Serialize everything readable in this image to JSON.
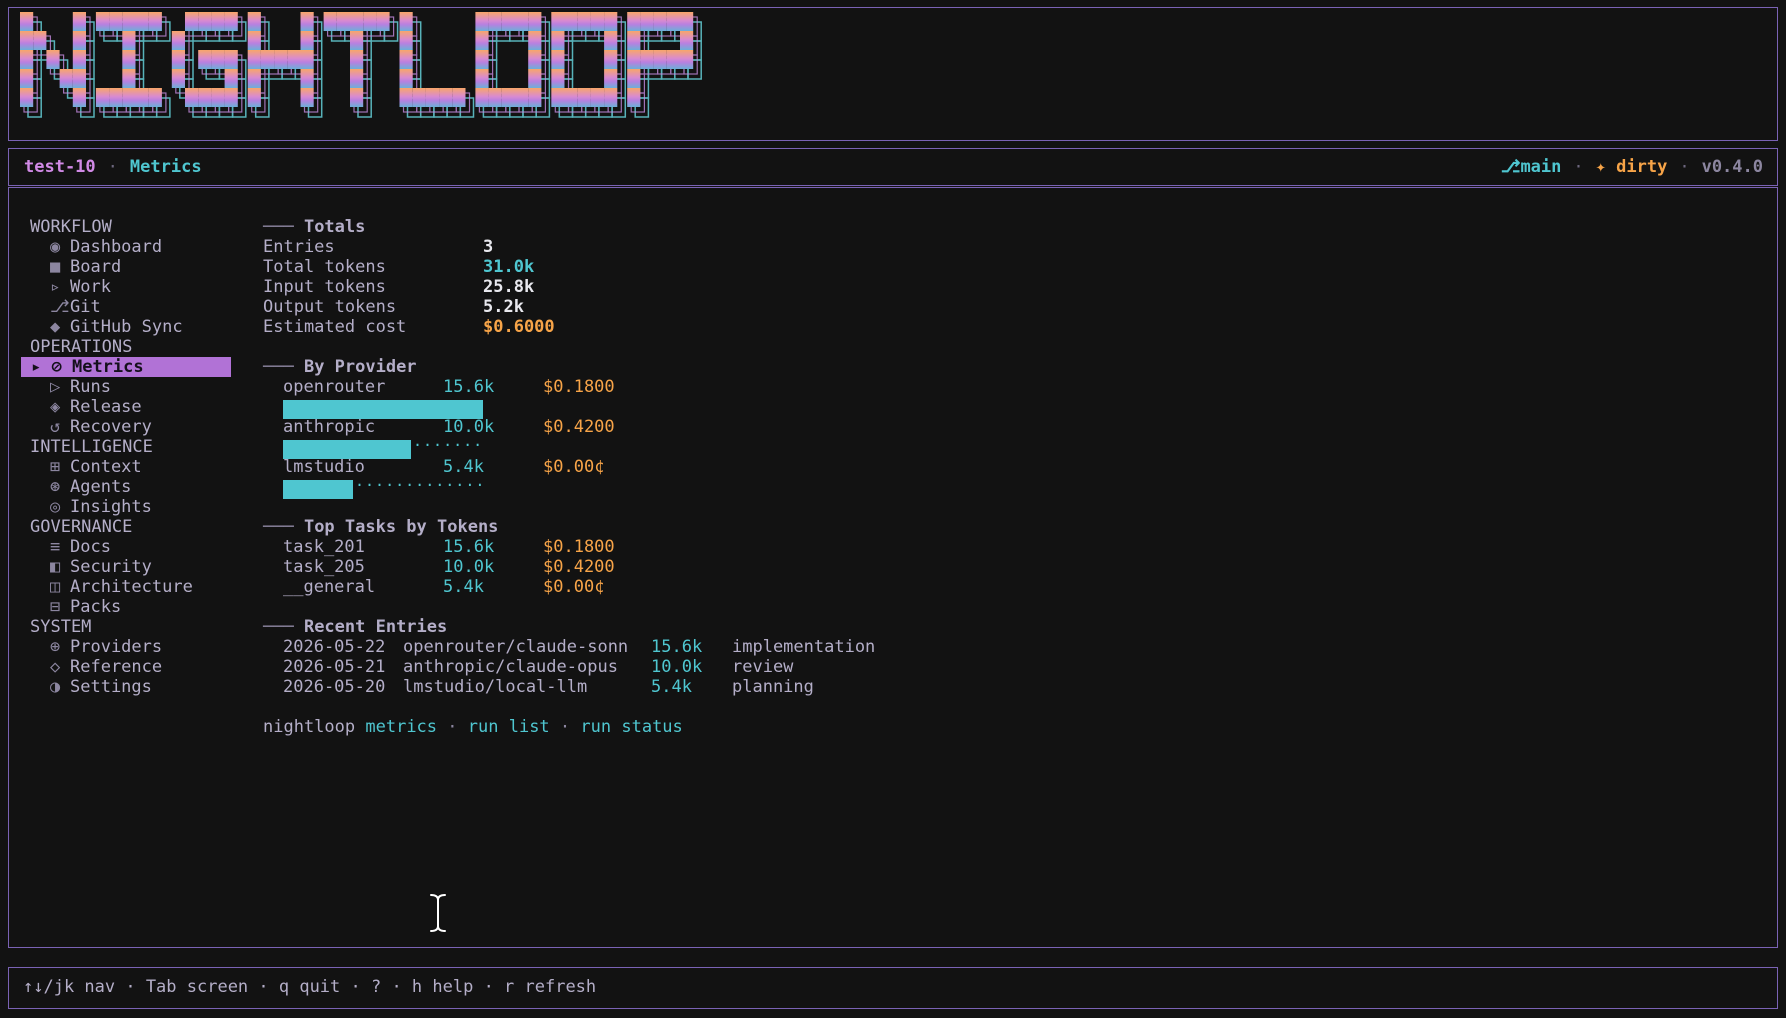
{
  "app": {
    "logo_text": "NIGHTLOOP",
    "colors": {
      "pink": "#d18ae6",
      "cyan": "#4fc6d0",
      "orange": "#f7a448",
      "border": "#7a62b4",
      "active_bg": "#b172d6"
    }
  },
  "header": {
    "project": "test-10",
    "screen": "Metrics",
    "branch_icon": "git-branch-icon",
    "branch_symbol": "⎇",
    "branch": "main",
    "dirty_symbol": "✦",
    "dirty": "dirty",
    "version": "v0.4.0"
  },
  "sidebar": {
    "sections": [
      {
        "label": "WORKFLOW",
        "items": [
          {
            "icon": "◉",
            "label": "Dashboard"
          },
          {
            "icon": "■",
            "label": "Board"
          },
          {
            "icon": "▹",
            "label": "Work"
          },
          {
            "icon": "⎇",
            "label": "Git"
          },
          {
            "icon": "◆",
            "label": "GitHub Sync"
          }
        ]
      },
      {
        "label": "OPERATIONS",
        "items": [
          {
            "icon": "▸ ⊘",
            "label": "Metrics",
            "active": true
          },
          {
            "icon": "▷",
            "label": "Runs"
          },
          {
            "icon": "◈",
            "label": "Release"
          },
          {
            "icon": "↺",
            "label": "Recovery"
          }
        ]
      },
      {
        "label": "INTELLIGENCE",
        "items": [
          {
            "icon": "⊞",
            "label": "Context"
          },
          {
            "icon": "⊛",
            "label": "Agents"
          },
          {
            "icon": "◎",
            "label": "Insights"
          }
        ]
      },
      {
        "label": "GOVERNANCE",
        "items": [
          {
            "icon": "≡",
            "label": "Docs"
          },
          {
            "icon": "◧",
            "label": "Security"
          },
          {
            "icon": "◫",
            "label": "Architecture"
          },
          {
            "icon": "⊟",
            "label": "Packs"
          }
        ]
      },
      {
        "label": "SYSTEM",
        "items": [
          {
            "icon": "⊕",
            "label": "Providers"
          },
          {
            "icon": "◇",
            "label": "Reference"
          },
          {
            "icon": "◑",
            "label": "Settings"
          }
        ]
      }
    ]
  },
  "totals": {
    "heading": "Totals",
    "rows": [
      {
        "label": "Entries",
        "value": "3"
      },
      {
        "label": "Total tokens",
        "value": "31.0k"
      },
      {
        "label": "Input tokens",
        "value": "25.8k"
      },
      {
        "label": "Output tokens",
        "value": "5.2k"
      },
      {
        "label": "Estimated cost",
        "value": "$0.6000"
      }
    ]
  },
  "providers": {
    "heading": "By Provider",
    "rows": [
      {
        "name": "openrouter",
        "tokens": "15.6k",
        "cost": "$0.1800",
        "share": 1.0
      },
      {
        "name": "anthropic",
        "tokens": "10.0k",
        "cost": "$0.4200",
        "share": 0.64
      },
      {
        "name": "lmstudio",
        "tokens": "5.4k",
        "cost": "$0.00¢",
        "share": 0.35
      }
    ]
  },
  "top_tasks": {
    "heading": "Top Tasks by Tokens",
    "rows": [
      {
        "name": "task_201",
        "tokens": "15.6k",
        "cost": "$0.1800"
      },
      {
        "name": "task_205",
        "tokens": "10.0k",
        "cost": "$0.4200"
      },
      {
        "name": "__general",
        "tokens": "5.4k",
        "cost": "$0.00¢"
      }
    ]
  },
  "recent": {
    "heading": "Recent Entries",
    "rows": [
      {
        "date": "2026-05-22",
        "model": "openrouter/claude-sonn",
        "tokens": "15.6k",
        "phase": "implementation"
      },
      {
        "date": "2026-05-21",
        "model": "anthropic/claude-opus",
        "tokens": "10.0k",
        "phase": "review"
      },
      {
        "date": "2026-05-20",
        "model": "lmstudio/local-llm",
        "tokens": "5.4k",
        "phase": "planning"
      }
    ]
  },
  "commands": {
    "prefix": "nightloop",
    "items": [
      "metrics",
      "run list",
      "run status"
    ],
    "separator": "·"
  },
  "footer": {
    "help": "↑↓/jk nav · Tab screen · q quit · ? · h help · r refresh"
  }
}
